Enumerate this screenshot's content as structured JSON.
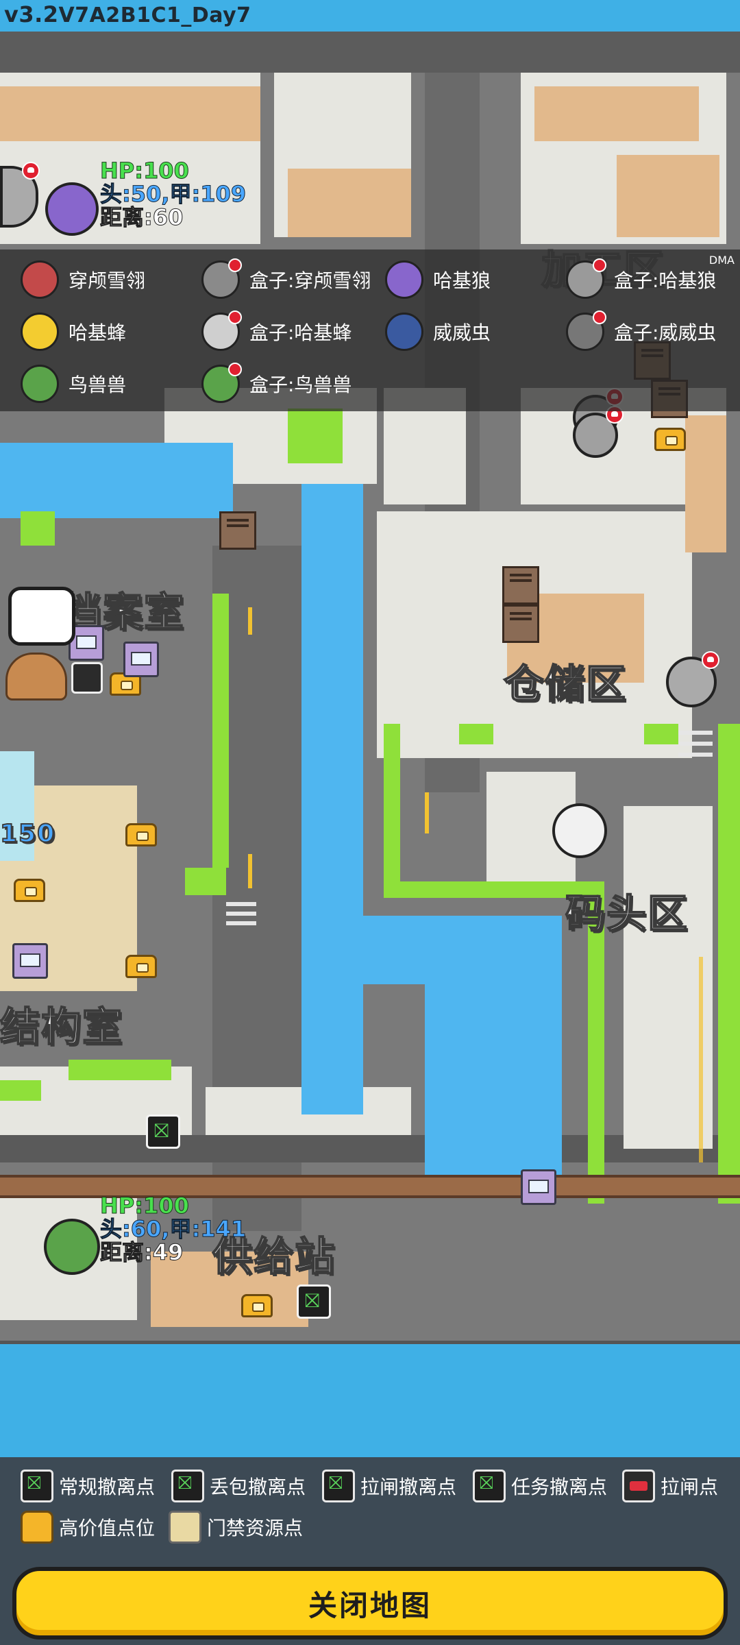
{
  "version": {
    "major": "v3.2",
    "build": "V7A2B1C1_Day7"
  },
  "map": {
    "zones": [
      {
        "id": "archives",
        "label": "档案室"
      },
      {
        "id": "warehouse",
        "label": "仓储区"
      },
      {
        "id": "dock",
        "label": "码头区"
      },
      {
        "id": "structure",
        "label": "结构室"
      },
      {
        "id": "supply",
        "label": "供给站"
      },
      {
        "id": "partial_top",
        "label": "加工区"
      },
      {
        "id": "partial_left",
        "label": "150"
      }
    ],
    "player_top": {
      "hp": "HP:100",
      "armor": "头:50,甲:109",
      "distance": "距离:60"
    },
    "player_bottom": {
      "hp": "HP:100",
      "armor": "头:60,甲:141",
      "distance": "距离:49"
    }
  },
  "overlay": {
    "tag": "DMA",
    "entries": [
      {
        "label": "穿颅雪翎",
        "color": "#c34a4a",
        "dead": false
      },
      {
        "label": "盒子:穿颅雪翎",
        "color": "#8a8a8a",
        "dead": true
      },
      {
        "label": "哈基狼",
        "color": "#8866cc",
        "dead": false
      },
      {
        "label": "盒子:哈基狼",
        "color": "#9a9a9a",
        "dead": true
      },
      {
        "label": "哈基蜂",
        "color": "#f3cc30",
        "dead": false
      },
      {
        "label": "盒子:哈基蜂",
        "color": "#cfcfcf",
        "dead": true
      },
      {
        "label": "威威虫",
        "color": "#3a5aa0",
        "dead": false
      },
      {
        "label": "盒子:威威虫",
        "color": "#777777",
        "dead": true
      },
      {
        "label": "鸟兽兽",
        "color": "#5aa34a",
        "dead": false
      },
      {
        "label": "盒子:鸟兽兽",
        "color": "#5aa34a",
        "dead": true
      }
    ]
  },
  "legend": {
    "items": [
      {
        "label": "常规撤离点",
        "icon": "exit-icon"
      },
      {
        "label": "丢包撤离点",
        "icon": "exit-drop-icon"
      },
      {
        "label": "拉闸撤离点",
        "icon": "exit-lever-icon"
      },
      {
        "label": "任务撤离点",
        "icon": "exit-task-icon"
      },
      {
        "label": "拉闸点",
        "icon": "lever-icon"
      },
      {
        "label": "高价值点位",
        "icon": "chest-icon"
      },
      {
        "label": "门禁资源点",
        "icon": "keycard-stack-icon"
      }
    ]
  },
  "close_button": {
    "label": "关闭地图"
  },
  "colors": {
    "water": "#4fb6f0",
    "grass": "#8fe03a",
    "road": "#6f6f6f",
    "tile": "#e6e6e0",
    "wood": "#e2b98c",
    "panel": "#3d4a55",
    "button": "#ffd21a"
  }
}
